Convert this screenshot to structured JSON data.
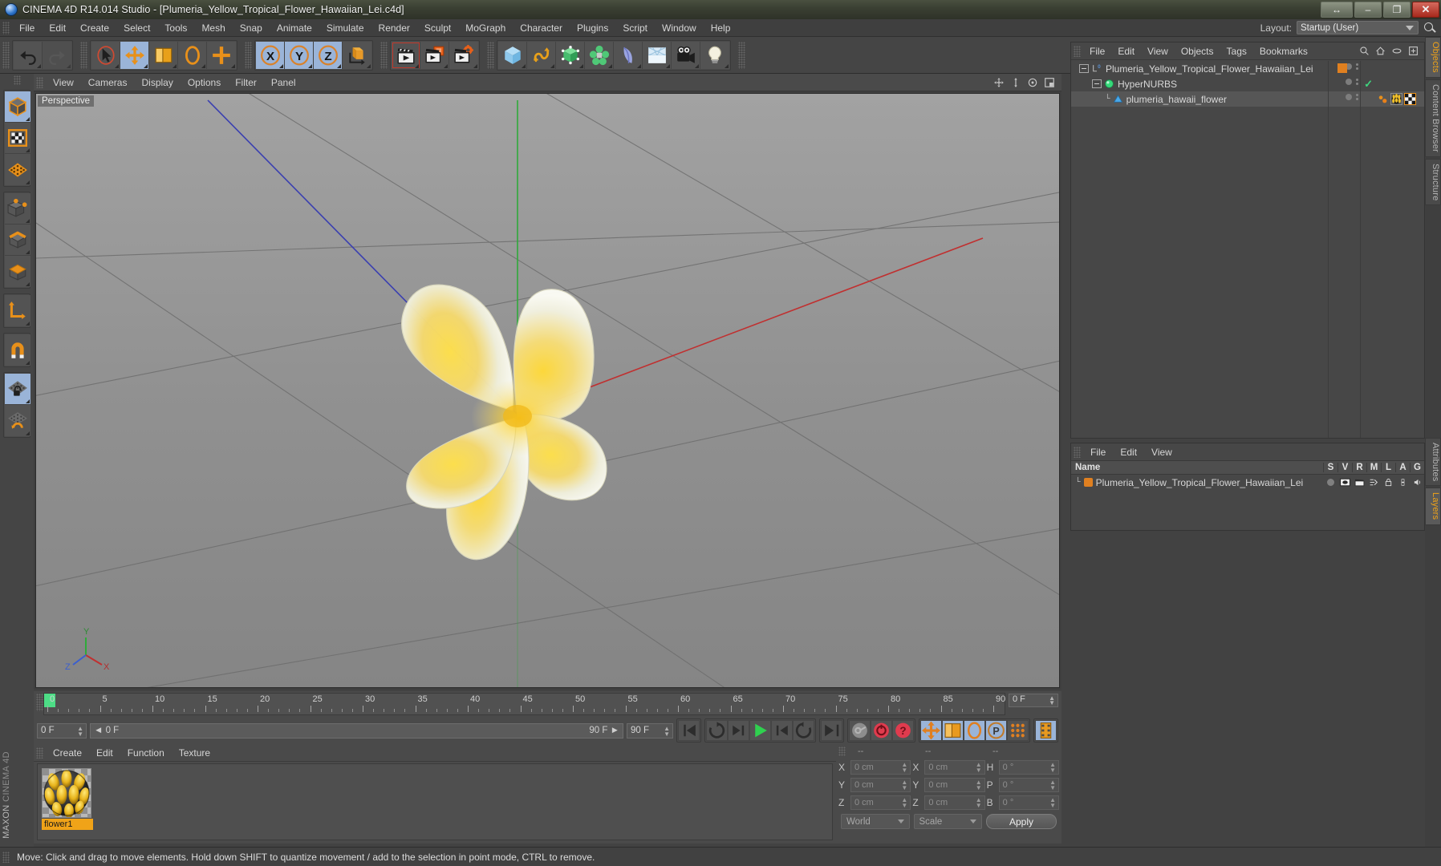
{
  "window": {
    "title": "CINEMA 4D R14.014 Studio - [Plumeria_Yellow_Tropical_Flower_Hawaiian_Lei.c4d]",
    "app_icon": "cinema4d-logo-icon",
    "buttons": {
      "restore_arrows": "↔",
      "minimize": "–",
      "maximize": "❐",
      "close": "✕"
    }
  },
  "menubar": {
    "items": [
      "File",
      "Edit",
      "Create",
      "Select",
      "Tools",
      "Mesh",
      "Snap",
      "Animate",
      "Simulate",
      "Render",
      "Sculpt",
      "MoGraph",
      "Character",
      "Plugins",
      "Script",
      "Window",
      "Help"
    ],
    "layout_label": "Layout:",
    "layout_value": "Startup (User)"
  },
  "toolbar": {
    "groups": [
      {
        "name": "undo-redo",
        "buttons": [
          {
            "name": "undo-button",
            "icon": "undo-arrow-icon",
            "state": "normal"
          },
          {
            "name": "redo-button",
            "icon": "redo-arrow-icon",
            "state": "disabled"
          }
        ]
      },
      {
        "name": "transform-tools",
        "buttons": [
          {
            "name": "live-selection-tool",
            "icon": "cursor-arrow-icon",
            "state": "normal"
          },
          {
            "name": "move-tool",
            "icon": "move-cross-icon",
            "state": "active"
          },
          {
            "name": "scale-tool",
            "icon": "scale-box-icon",
            "state": "normal"
          },
          {
            "name": "rotate-tool",
            "icon": "rotate-ring-icon",
            "state": "normal"
          },
          {
            "name": "add-tool",
            "icon": "plus-cross-icon",
            "state": "normal"
          }
        ]
      },
      {
        "name": "axis-locks",
        "buttons": [
          {
            "name": "lock-x-axis",
            "icon": "x-axis-icon",
            "state": "active"
          },
          {
            "name": "lock-y-axis",
            "icon": "y-axis-icon",
            "state": "active"
          },
          {
            "name": "lock-z-axis",
            "icon": "z-axis-icon",
            "state": "active"
          },
          {
            "name": "world-object-coordinate-toggle",
            "icon": "world-axis-icon",
            "state": "normal"
          }
        ]
      },
      {
        "name": "render-tools",
        "buttons": [
          {
            "name": "render-view-button",
            "icon": "clapperboard-icon",
            "state": "outlined"
          },
          {
            "name": "render-to-picture-viewer-button",
            "icon": "clapperboard-picture-icon",
            "state": "normal"
          },
          {
            "name": "render-settings-button",
            "icon": "clapperboard-gear-icon",
            "state": "normal"
          }
        ]
      },
      {
        "name": "create-objects",
        "buttons": [
          {
            "name": "add-cube-button",
            "icon": "cube-icon",
            "state": "normal"
          },
          {
            "name": "add-spline-button",
            "icon": "spline-curve-icon",
            "state": "normal"
          },
          {
            "name": "add-nurbs-button",
            "icon": "nurbs-green-cube-icon",
            "state": "normal"
          },
          {
            "name": "add-array-button",
            "icon": "array-green-icon",
            "state": "normal"
          },
          {
            "name": "add-deformer-button",
            "icon": "bend-deformer-icon",
            "state": "normal"
          },
          {
            "name": "add-floor-button",
            "icon": "floor-environment-icon",
            "state": "normal"
          },
          {
            "name": "add-camera-button",
            "icon": "camera-icon",
            "state": "normal"
          },
          {
            "name": "add-light-button",
            "icon": "light-bulb-icon",
            "state": "normal"
          }
        ]
      }
    ]
  },
  "left_toolbar": {
    "groups": [
      [
        {
          "name": "model-mode-button",
          "icon": "model-cube-icon",
          "state": "active"
        },
        {
          "name": "texture-mode-button",
          "icon": "texture-checker-icon",
          "state": "normal"
        },
        {
          "name": "deformed-points-button",
          "icon": "orange-grid-plane-icon",
          "state": "normal"
        }
      ],
      [
        {
          "name": "points-mode-button",
          "icon": "points-cube-icon",
          "state": "normal"
        },
        {
          "name": "edges-mode-button",
          "icon": "edges-cube-icon",
          "state": "normal"
        },
        {
          "name": "polygons-mode-button",
          "icon": "polygons-cube-icon",
          "state": "normal"
        }
      ],
      [
        {
          "name": "object-axis-mode-button",
          "icon": "axis-corner-icon",
          "state": "normal"
        }
      ],
      [
        {
          "name": "enable-snapping-button",
          "icon": "magnet-icon",
          "state": "normal"
        }
      ],
      [
        {
          "name": "lock-workplane-button",
          "icon": "locked-grid-icon",
          "state": "active"
        },
        {
          "name": "workplane-mode-button",
          "icon": "grid-rotate-icon",
          "state": "normal"
        }
      ]
    ],
    "brand_line1": "MAXON",
    "brand_line2": "CINEMA 4D"
  },
  "viewport": {
    "menu": [
      "View",
      "Cameras",
      "Display",
      "Options",
      "Filter",
      "Panel"
    ],
    "label": "Perspective",
    "header_icons": [
      "pan-view-icon",
      "dolly-view-icon",
      "rotate-view-icon",
      "maximize-view-icon"
    ],
    "axis_gizmo": {
      "y": "Y",
      "x": "X",
      "z": "Z"
    },
    "scene_object": "yellow plumeria flower with five petals"
  },
  "timeline": {
    "ticks": [
      0,
      5,
      10,
      15,
      20,
      25,
      30,
      35,
      40,
      45,
      50,
      55,
      60,
      65,
      70,
      75,
      80,
      85,
      90
    ],
    "current_frame_marker": 0,
    "end_field": "0 F",
    "current_frame": "0 F",
    "range_start": "0 F",
    "range_end": "90 F",
    "max_frame": "90 F",
    "playback": [
      {
        "name": "go-to-start-button",
        "icon": "skip-start-icon"
      },
      {
        "name": "play-reverse-loop-button",
        "icon": "loop-reverse-icon"
      },
      {
        "name": "previous-frame-button",
        "icon": "step-back-icon"
      },
      {
        "name": "play-button",
        "icon": "play-triangle-icon"
      },
      {
        "name": "next-frame-button",
        "icon": "step-forward-icon"
      },
      {
        "name": "play-forward-loop-button",
        "icon": "loop-forward-icon"
      },
      {
        "name": "go-to-end-button",
        "icon": "skip-end-icon"
      },
      {
        "name": "record-active-objects-button",
        "icon": "record-disabled-icon"
      },
      {
        "name": "autokeying-button",
        "icon": "autokey-red-icon"
      },
      {
        "name": "keyframe-selection-button",
        "icon": "question-red-icon"
      },
      {
        "name": "position-key-button",
        "icon": "move-cross-icon"
      },
      {
        "name": "scale-key-button",
        "icon": "scale-box-icon"
      },
      {
        "name": "rotation-key-button",
        "icon": "rotate-ring-icon"
      },
      {
        "name": "parameter-key-button",
        "icon": "p-circle-icon"
      },
      {
        "name": "point-level-animation-button",
        "icon": "dot-matrix-icon"
      },
      {
        "name": "timeline-filmstrip-button",
        "icon": "filmstrip-icon"
      }
    ]
  },
  "material_manager": {
    "menu": [
      "Create",
      "Edit",
      "Function",
      "Texture"
    ],
    "materials": [
      {
        "name": "flower1",
        "preview": "yellow-black-flower-sphere-preview"
      }
    ]
  },
  "coordinates": {
    "headers": [
      "--",
      "--",
      "--"
    ],
    "rows": [
      {
        "pos_label": "X",
        "pos_value": "0 cm",
        "size_label": "X",
        "size_value": "0 cm",
        "rot_label": "H",
        "rot_value": "0 °"
      },
      {
        "pos_label": "Y",
        "pos_value": "0 cm",
        "size_label": "Y",
        "size_value": "0 cm",
        "rot_label": "P",
        "rot_value": "0 °"
      },
      {
        "pos_label": "Z",
        "pos_value": "0 cm",
        "size_label": "Z",
        "size_value": "0 cm",
        "rot_label": "B",
        "rot_value": "0 °"
      }
    ],
    "system_select": "World",
    "mode_select": "Scale",
    "apply_label": "Apply"
  },
  "object_manager": {
    "menu": [
      "File",
      "Edit",
      "View",
      "Objects",
      "Tags",
      "Bookmarks"
    ],
    "header_icons": [
      "search-icon",
      "home-icon",
      "eye-icon",
      "plus-box-icon"
    ],
    "rows": [
      {
        "name": "Plumeria_Yellow_Tropical_Flower_Hawaiian_Lei",
        "depth": 0,
        "icon": "layer-zero-icon",
        "selected": false,
        "tag_color": "#e08020",
        "expander": "minus"
      },
      {
        "name": "HyperNURBS",
        "depth": 1,
        "icon": "hypernurbs-green-sphere-icon",
        "selected": false,
        "tag_check": true,
        "expander": "minus"
      },
      {
        "name": "plumeria_hawaii_flower",
        "depth": 2,
        "icon": "polygon-object-blue-icon",
        "selected": true,
        "tags": [
          "point-cloud-tag",
          "flower-material-tag",
          "checker-texture-tag"
        ],
        "expander": "none"
      }
    ]
  },
  "layer_manager": {
    "menu": [
      "File",
      "Edit",
      "View"
    ],
    "columns": [
      "Name",
      "S",
      "V",
      "R",
      "M",
      "L",
      "A",
      "G"
    ],
    "rows": [
      {
        "name": "Plumeria_Yellow_Tropical_Flower_Hawaiian_Lei",
        "color": "#e08020",
        "s": "solo-dot-icon",
        "v": "visible-icon",
        "r": "render-icon",
        "m": "manager-icon",
        "l": "lock-icon",
        "a": "animation-icon",
        "g": "generator-icon"
      }
    ]
  },
  "edge_tabs": {
    "top": [
      {
        "label": "Objects",
        "active": true
      },
      {
        "label": "Content Browser",
        "active": false
      },
      {
        "label": "Structure",
        "active": false
      }
    ],
    "bottom": [
      {
        "label": "Attributes",
        "active": false
      },
      {
        "label": "Layers",
        "active": true
      }
    ]
  },
  "status_bar": {
    "message": "Move: Click and drag to move elements. Hold down SHIFT to quantize movement / add to the selection in point mode, CTRL to remove."
  }
}
